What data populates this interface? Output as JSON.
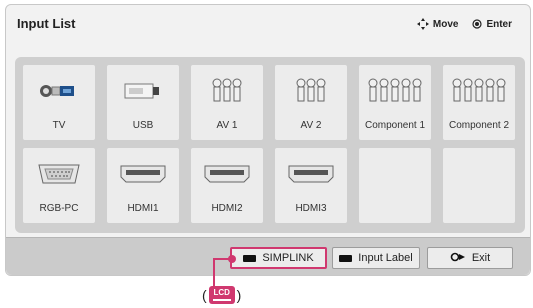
{
  "header": {
    "title": "Input List",
    "move_label": "Move",
    "enter_label": "Enter"
  },
  "inputs": [
    {
      "label": "TV",
      "icon": "tv-antenna-icon"
    },
    {
      "label": "USB",
      "icon": "usb-icon"
    },
    {
      "label": "AV 1",
      "icon": "rca-connectors-icon"
    },
    {
      "label": "AV 2",
      "icon": "rca-connectors-icon"
    },
    {
      "label": "Component 1",
      "icon": "component-connectors-icon"
    },
    {
      "label": "Component 2",
      "icon": "component-connectors-icon"
    },
    {
      "label": "RGB-PC",
      "icon": "vga-port-icon"
    },
    {
      "label": "HDMI1",
      "icon": "hdmi-port-icon"
    },
    {
      "label": "HDMI2",
      "icon": "hdmi-port-icon"
    },
    {
      "label": "HDMI3",
      "icon": "hdmi-port-icon"
    },
    {
      "label": "",
      "icon": ""
    },
    {
      "label": "",
      "icon": ""
    }
  ],
  "buttons": {
    "simplink": "SIMPLINK",
    "input_label": "Input Label",
    "exit": "Exit"
  },
  "note": {
    "open_paren": "(",
    "badge": "LCD",
    "close_paren": ")"
  },
  "colors": {
    "highlight": "#d0386f",
    "panel_bg": "#f2f2f2",
    "tile_bg": "#ececec"
  }
}
